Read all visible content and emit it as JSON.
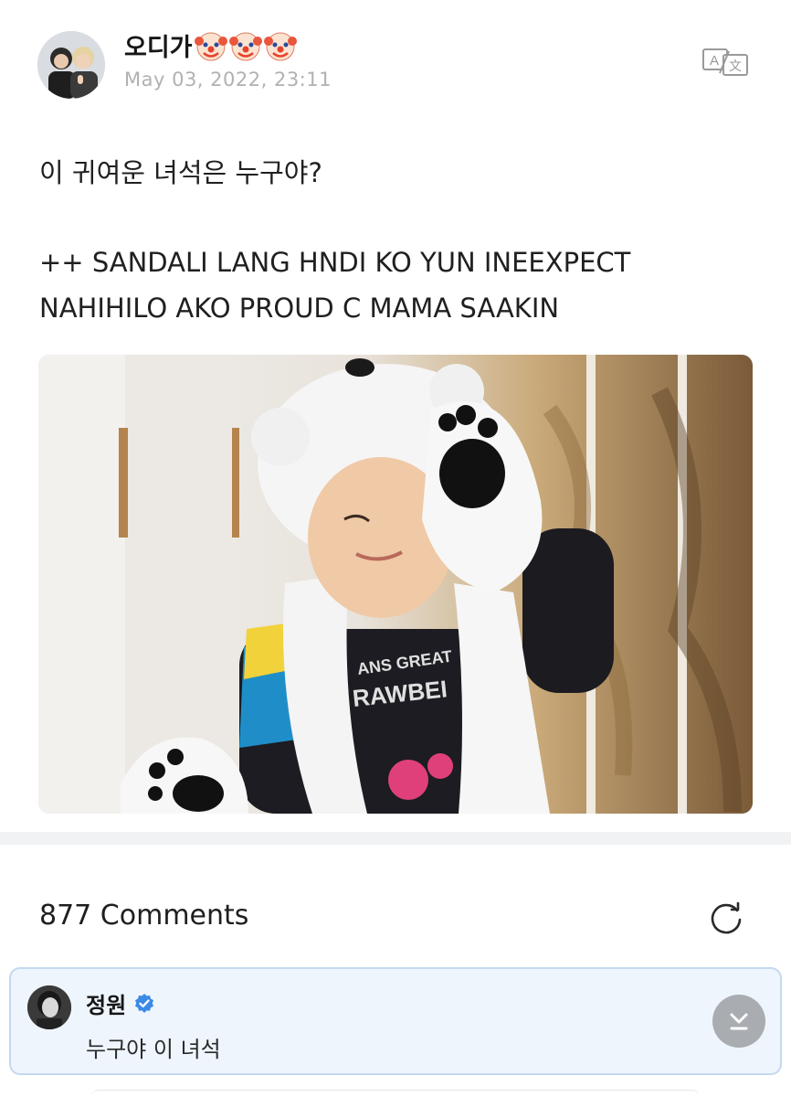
{
  "post": {
    "author": "오디가",
    "author_emojis": [
      "clown-face-icon",
      "clown-face-icon",
      "clown-face-icon"
    ],
    "date": "May 03, 2022, 23:11",
    "text_line1": "이 귀여운 녀석은 누구야?",
    "text_line2": "++ SANDALI LANG HNDI KO YUN INEEXPECT\nNAHIHILO AKO PROUD C MAMA SAAKIN",
    "image_icon": "photo-child-polar-bear-hat",
    "image_shirt_text": "ANS GREAT\nRAWBEI"
  },
  "comments": {
    "count_label": "877 Comments",
    "pinned": {
      "author": "정원",
      "text": "누구야 이 녀석"
    }
  },
  "colors": {
    "accent_blue": "#3b8ae6",
    "pinned_bg": "#eef5fd",
    "pinned_border": "#c3d9ef",
    "date_gray": "#b1b1b1"
  },
  "icons": {
    "translate": "translate-icon",
    "refresh": "refresh-icon",
    "verified": "verified-badge-icon",
    "expand": "chevron-down-icon"
  }
}
